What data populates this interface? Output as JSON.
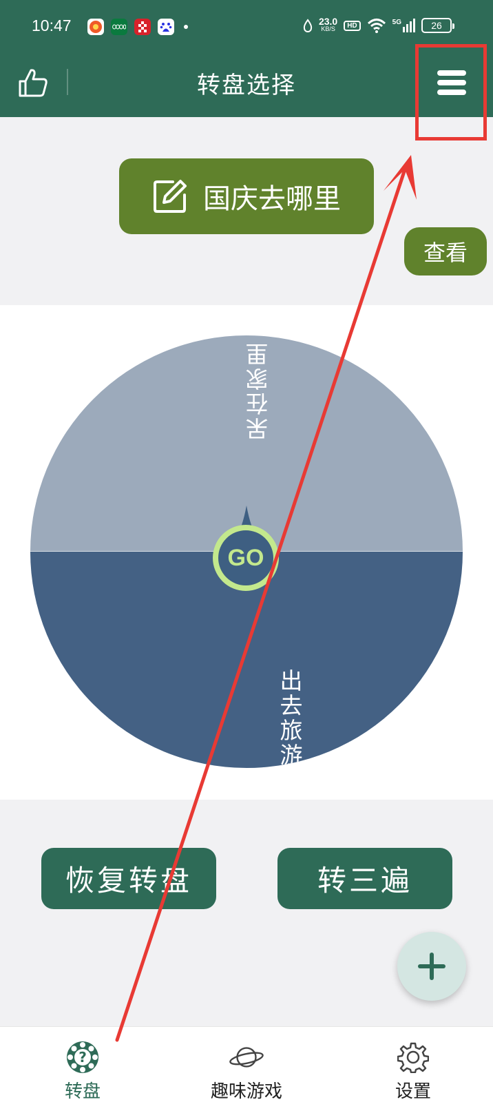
{
  "status_bar": {
    "time": "10:47",
    "app_icons": [
      "coupon-app-icon",
      "oppo-app-icon",
      "pattern-app-icon",
      "baidu-app-icon"
    ],
    "net_speed_value": "23.0",
    "net_speed_unit": "KB/S",
    "hd_label": "HD",
    "signal_label": "5G",
    "battery": "26"
  },
  "header": {
    "title": "转盘选择",
    "left_icon": "thumbs-up-icon",
    "right_icon": "hamburger-menu-icon"
  },
  "wheel_title": {
    "text": "国庆去哪里",
    "icon": "edit-icon"
  },
  "view_button_label": "查看",
  "wheel": {
    "segments": [
      {
        "label": "呆在家里",
        "color": "#9caabb"
      },
      {
        "label": "出去旅游",
        "color": "#446184"
      }
    ],
    "go_label": "GO"
  },
  "actions": {
    "restore_label": "恢复转盘",
    "spin_three_label": "转三遍"
  },
  "fab_icon": "plus-icon",
  "bottom_nav": [
    {
      "label": "转盘",
      "icon": "wheel-question-icon",
      "active": true
    },
    {
      "label": "趣味游戏",
      "icon": "planet-icon",
      "active": false
    },
    {
      "label": "设置",
      "icon": "gear-icon",
      "active": false
    }
  ],
  "colors": {
    "primary": "#2e6b57",
    "title_green": "#60822c",
    "go_ring": "#c3e88d",
    "annotation_red": "#e83a34"
  }
}
